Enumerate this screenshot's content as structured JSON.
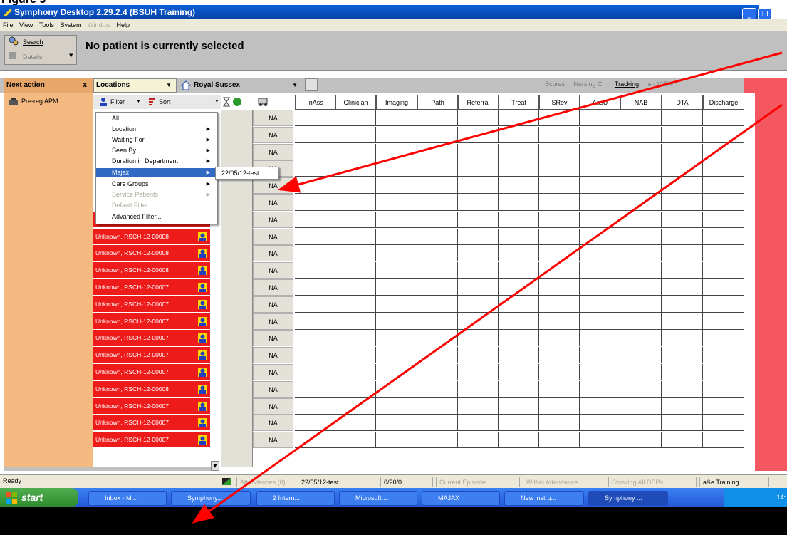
{
  "figure_caption": "Figure 3",
  "window": {
    "title": "Symphony Desktop 2.29.2.4 (BSUH Training)",
    "minimize_glyph": "_",
    "restore_glyph": "❐"
  },
  "menubar": [
    "File",
    "View",
    "Tools",
    "System",
    "Window",
    "Help"
  ],
  "toolbar": {
    "search_label": "Search",
    "details_label": "Details",
    "no_patient_text": "No patient is currently selected"
  },
  "header": {
    "next_action_label": "Next action",
    "next_action_close": "x",
    "locations_label": "Locations",
    "site_label": "Royal Sussex",
    "right_buttons": [
      "Scores",
      "Nursing Ch",
      "Tracking",
      "e - VIEW"
    ]
  },
  "left_panel": {
    "item": "Pre-reg APM"
  },
  "filter_bar": {
    "filter_label": "Filter",
    "sort_label": "Sort"
  },
  "columns": [
    "InAss",
    "Clinician",
    "Imaging",
    "Path",
    "Referral",
    "Treat",
    "SRev",
    "AssU",
    "NAB",
    "DTA",
    "Discharge"
  ],
  "na_text": "NA",
  "patients": [
    "",
    "",
    "",
    "",
    "",
    "",
    "Unknown, RSCH-12-00008",
    "Unknown, RSCH-12-00008",
    "Unknown, RSCH-12-00008",
    "Unknown, RSCH-12-00008",
    "Unknown, RSCH-12-00007",
    "Unknown, RSCH-12-00007",
    "Unknown, RSCH-12-00007",
    "Unknown, RSCH-12-00007",
    "Unknown, RSCH-12-00007",
    "Unknown, RSCH-12-00007",
    "Unknown, RSCH-12-00008",
    "Unknown, RSCH-12-00007",
    "Unknown, RSCH-12-00007",
    "Unknown, RSCH-12-00007"
  ],
  "filter_menu": {
    "items": [
      {
        "label": "All",
        "arrow": false,
        "state": "normal"
      },
      {
        "label": "Location",
        "arrow": true,
        "state": "normal"
      },
      {
        "label": "Waiting For",
        "arrow": true,
        "state": "normal"
      },
      {
        "label": "Seen By",
        "arrow": true,
        "state": "normal"
      },
      {
        "label": "Duration in Department",
        "arrow": true,
        "state": "normal"
      },
      {
        "label": "Majax",
        "arrow": true,
        "state": "selected"
      },
      {
        "label": "Care Groups",
        "arrow": true,
        "state": "normal"
      },
      {
        "label": "Service Patients",
        "arrow": true,
        "state": "disabled"
      },
      {
        "label": "Default Filter",
        "arrow": false,
        "state": "disabled"
      },
      {
        "label": "Advanced Filter...",
        "arrow": false,
        "state": "normal"
      }
    ],
    "submenu_item": "22/05/12-test"
  },
  "statusbar": {
    "ready": "Ready",
    "attendances": "Attendances (0)",
    "filter_value": "22/05/12-test",
    "counts": "0/20/0",
    "current_episode": "Current Episode",
    "within_attendance": "Within Attendance",
    "showing": "Showing All DEPs",
    "profile": "a&e Training"
  },
  "taskbar": {
    "start_label": "start",
    "buttons": [
      "Inbox - Mi...",
      "Symphony...",
      "2 Intern...",
      "Microsoft ...",
      "MAJAX",
      "New instru...",
      "Symphony ..."
    ],
    "clock": "14:"
  },
  "colors": {
    "titlebar": "#0a5fd8",
    "patient_red": "#ee1b1b",
    "left_panel": "#f5b982",
    "arrow": "#ff0000",
    "right_red": "#f4575f"
  }
}
